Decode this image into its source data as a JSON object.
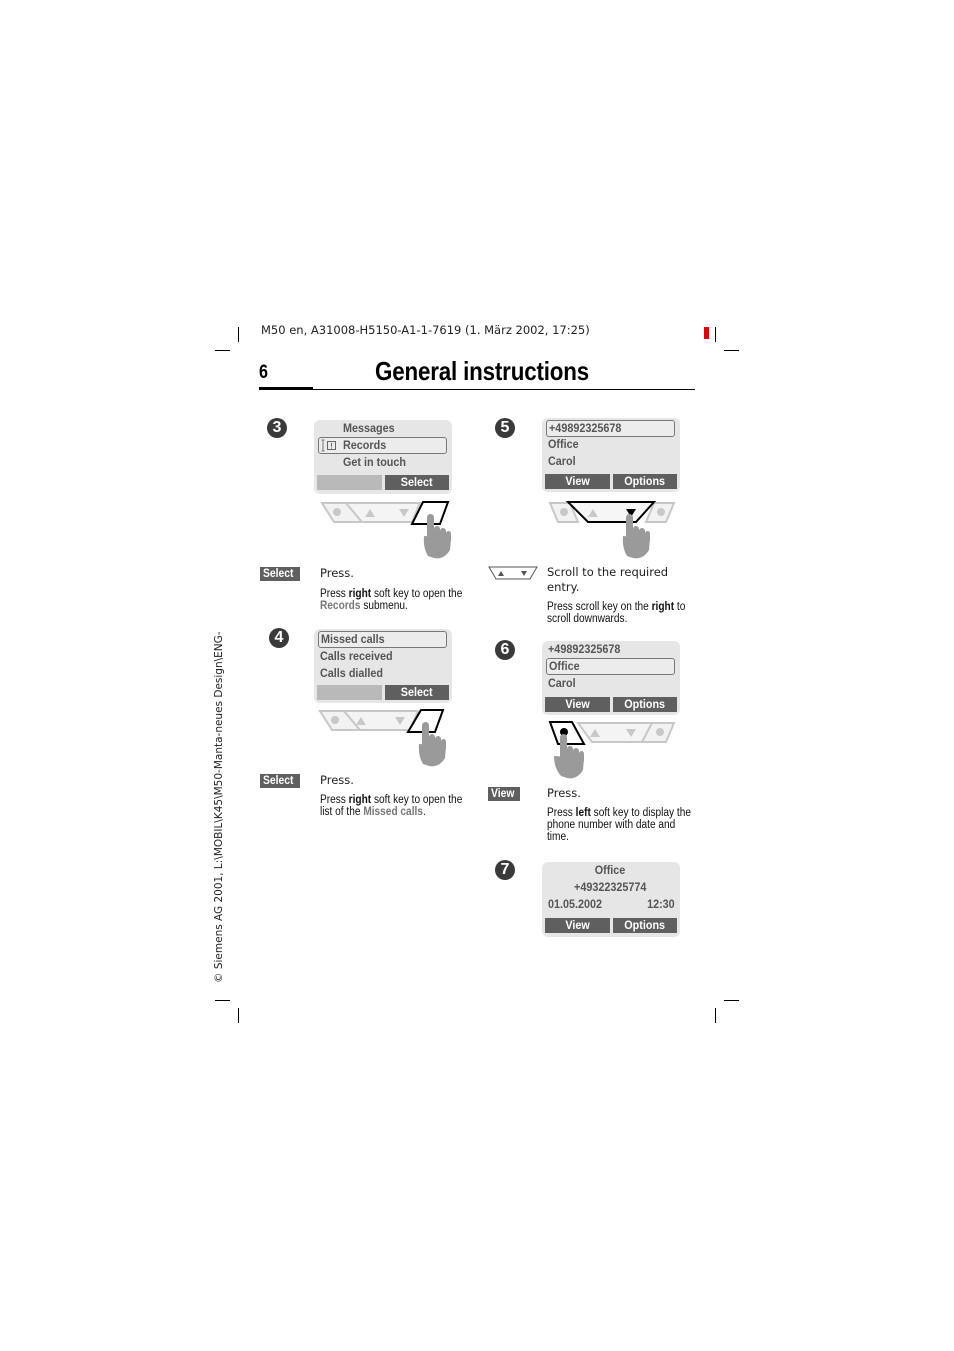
{
  "header": {
    "doc_ref": "M50 en, A31008-H5150-A1-1-7619 (1. März 2002, 17:25)",
    "page_number": "6",
    "title": "General instructions",
    "side_text": "© Siemens AG 2001, L:\\MOBIL\\K45\\M50-Manta-neues Design\\ENG-",
    "accent_color": "#e3000f"
  },
  "steps": [
    {
      "number": "3",
      "screen": {
        "rows": [
          "Messages",
          "Records",
          "Get in touch"
        ],
        "selected_row": "Records",
        "row_icon": "records-icon",
        "softkeys": [
          "",
          "Select"
        ]
      },
      "keypad": {
        "pressed": "right-soft-key"
      },
      "key_label": "Select",
      "action": "Press.",
      "description": {
        "pre": "Press ",
        "bold": "right",
        "mid": " soft key to open the ",
        "highlight": "Records",
        "post": " submenu."
      }
    },
    {
      "number": "4",
      "screen": {
        "rows": [
          "Missed calls",
          "Calls received",
          "Calls dialled"
        ],
        "selected_row": "Missed calls",
        "softkeys": [
          "",
          "Select"
        ]
      },
      "keypad": {
        "pressed": "right-soft-key"
      },
      "key_label": "Select",
      "action": "Press.",
      "description": {
        "pre": "Press ",
        "bold": "right",
        "mid": " soft key to open the list of the ",
        "highlight": "Missed calls",
        "post": "."
      }
    },
    {
      "number": "5",
      "screen": {
        "rows": [
          "+49892325678",
          "Office",
          "Carol"
        ],
        "selected_row": "+49892325678",
        "softkeys": [
          "View",
          "Options"
        ]
      },
      "keypad": {
        "pressed": "scroll-key-down"
      },
      "key_label_icon": "scroll-key-icon",
      "action": "Scroll to the required entry.",
      "description": {
        "pre": "Press scroll key on the ",
        "bold": "right",
        "mid": " to scroll downwards.",
        "highlight": "",
        "post": ""
      }
    },
    {
      "number": "6",
      "screen": {
        "rows": [
          "+49892325678",
          "Office",
          "Carol"
        ],
        "selected_row": "Office",
        "softkeys": [
          "View",
          "Options"
        ]
      },
      "keypad": {
        "pressed": "left-soft-key"
      },
      "key_label": "View",
      "action": "Press.",
      "description": {
        "pre": "Press ",
        "bold": "left",
        "mid": " soft key to display the phone number with date and time.",
        "highlight": "",
        "post": ""
      }
    },
    {
      "number": "7",
      "screen": {
        "rows": [
          "Office",
          "+49322325774"
        ],
        "date": "01.05.2002",
        "time": "12:30",
        "softkeys": [
          "View",
          "Options"
        ]
      }
    }
  ]
}
